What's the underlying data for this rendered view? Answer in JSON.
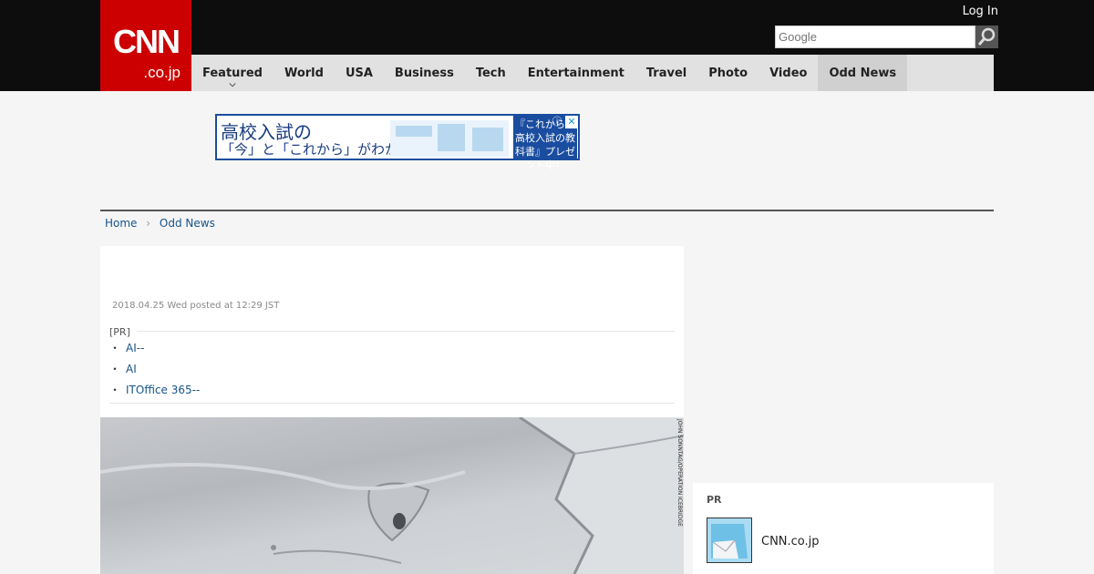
{
  "header": {
    "logo_main": "CNN",
    "logo_sub": ".co.jp",
    "login_label": "Log In",
    "search_placeholder": "Google"
  },
  "nav": {
    "items": [
      {
        "label": "Featured"
      },
      {
        "label": "World"
      },
      {
        "label": "USA"
      },
      {
        "label": "Business"
      },
      {
        "label": "Tech"
      },
      {
        "label": "Entertainment"
      },
      {
        "label": "Travel"
      },
      {
        "label": "Photo"
      },
      {
        "label": "Video"
      },
      {
        "label": "Odd News"
      }
    ],
    "active": "Odd News"
  },
  "ad": {
    "line1": "高校入試の",
    "line2": "「今」と「これから」がわかる。",
    "cta": "『これからの高校入試の教科書』プレゼント中！"
  },
  "breadcrumb": {
    "home": "Home",
    "section": "Odd News"
  },
  "article": {
    "dateline": "2018.04.25 Wed posted at 12:29 JST",
    "pr_label": "[PR]",
    "pr_links": [
      "AI--",
      "AI",
      "ITOffice 365--"
    ],
    "photo_credit": "JOHN SONNTAG/OPERATION ICEBRIDGE"
  },
  "sidebar": {
    "pr_label": "PR",
    "item_title": "CNN.co.jp"
  },
  "colors": {
    "brand_red": "#cc0000",
    "link_blue": "#17548a",
    "header_black": "#0d0d0d"
  }
}
